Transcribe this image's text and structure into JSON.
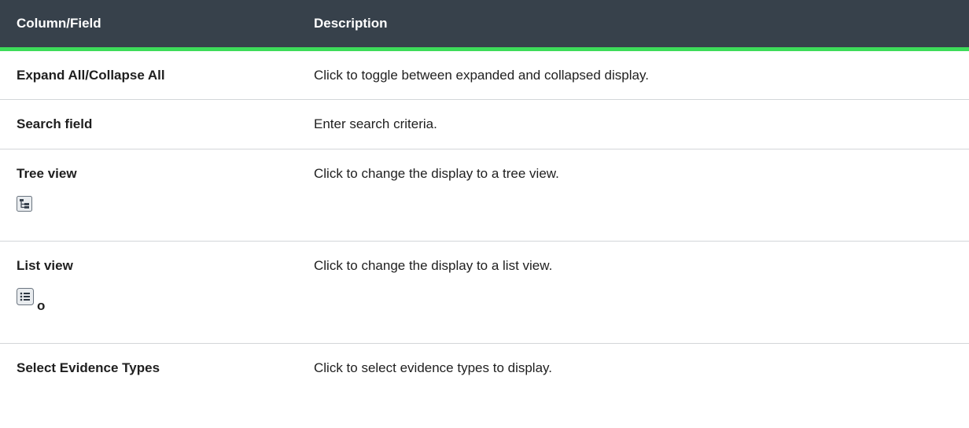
{
  "table": {
    "headers": {
      "field": "Column/Field",
      "description": "Description"
    },
    "rows": [
      {
        "field": "Expand All/Collapse All",
        "description": "Click to toggle between expanded and collapsed display."
      },
      {
        "field": "Search field",
        "description": "Enter search criteria."
      },
      {
        "field": "Tree view",
        "description": "Click to change the display to a tree view.",
        "icon": "tree-view-icon"
      },
      {
        "field": "List view",
        "description": "Click to change the display to a list view.",
        "icon": "list-view-icon",
        "icon_suffix": "o"
      },
      {
        "field": "Select Evidence Types",
        "description": "Click to select evidence types to display."
      }
    ]
  },
  "colors": {
    "header_bg": "#37414b",
    "header_accent": "#3ddc5a",
    "row_border": "#d3d6d9"
  }
}
